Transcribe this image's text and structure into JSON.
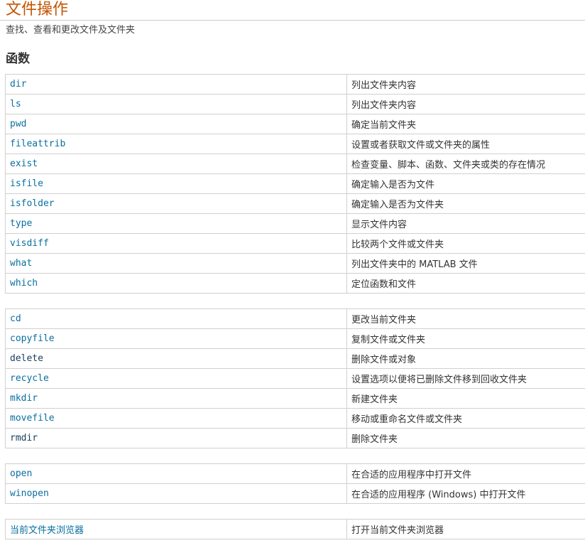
{
  "page": {
    "title": "文件操作",
    "subtitle": "查找、查看和更改文件及文件夹",
    "section_heading": "函数"
  },
  "groups": [
    {
      "rows": [
        {
          "name": "dir",
          "desc": "列出文件夹内容"
        },
        {
          "name": "ls",
          "desc": "列出文件夹内容"
        },
        {
          "name": "pwd",
          "desc": "确定当前文件夹"
        },
        {
          "name": "fileattrib",
          "desc": "设置或者获取文件或文件夹的属性"
        },
        {
          "name": "exist",
          "desc": "检查变量、脚本、函数、文件夹或类的存在情况"
        },
        {
          "name": "isfile",
          "desc": "确定输入是否为文件"
        },
        {
          "name": "isfolder",
          "desc": "确定输入是否为文件夹"
        },
        {
          "name": "type",
          "desc": "显示文件内容"
        },
        {
          "name": "visdiff",
          "desc": "比较两个文件或文件夹"
        },
        {
          "name": "what",
          "desc": "列出文件夹中的 MATLAB 文件"
        },
        {
          "name": "which",
          "desc": "定位函数和文件"
        }
      ]
    },
    {
      "rows": [
        {
          "name": "cd",
          "desc": "更改当前文件夹"
        },
        {
          "name": "copyfile",
          "desc": "复制文件或文件夹"
        },
        {
          "name": "delete",
          "desc": "删除文件或对象"
        },
        {
          "name": "recycle",
          "desc": "设置选项以便将已删除文件移到回收文件夹"
        },
        {
          "name": "mkdir",
          "desc": "新建文件夹"
        },
        {
          "name": "movefile",
          "desc": "移动或重命名文件或文件夹"
        },
        {
          "name": "rmdir",
          "desc": "删除文件夹"
        }
      ]
    },
    {
      "rows": [
        {
          "name": "open",
          "desc": "在合适的应用程序中打开文件"
        },
        {
          "name": "winopen",
          "desc": "在合适的应用程序 (Windows) 中打开文件"
        }
      ]
    },
    {
      "rows": [
        {
          "name": "当前文件夹浏览器",
          "desc": "打开当前文件夹浏览器"
        }
      ]
    }
  ],
  "colors": {
    "title": "#c45400",
    "link": "#0a6fa0",
    "border": "#d0d0d0"
  }
}
